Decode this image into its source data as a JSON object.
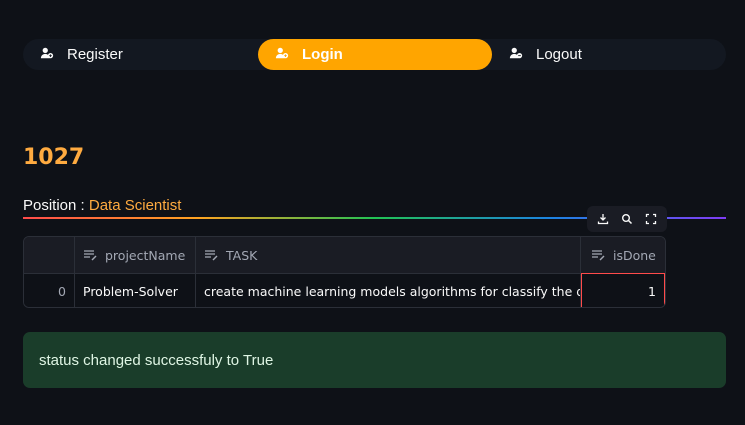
{
  "nav": {
    "items": [
      {
        "label": "Register",
        "icon": "user-add-icon",
        "active": false
      },
      {
        "label": "Login",
        "icon": "user-add-icon",
        "active": true
      },
      {
        "label": "Logout",
        "icon": "user-remove-icon",
        "active": false
      }
    ]
  },
  "header": {
    "id": "1027",
    "position_label": "Position : ",
    "position_value": "Data Scientist"
  },
  "toolbar": {
    "icons": [
      "download-icon",
      "search-icon",
      "fullscreen-icon"
    ]
  },
  "table": {
    "columns": [
      "",
      "projectName",
      "TASK",
      "isDone"
    ],
    "rows": [
      {
        "index": "0",
        "projectName": "Problem-Solver",
        "task": "create machine learning models algorithms for classify the data",
        "isDone": "1"
      }
    ]
  },
  "status": {
    "message": "status changed successfuly to True"
  },
  "colors": {
    "background": "#0e1117",
    "accent": "#ffa500",
    "highlight": "#ffab40",
    "success_bg": "#1a3d2a"
  }
}
